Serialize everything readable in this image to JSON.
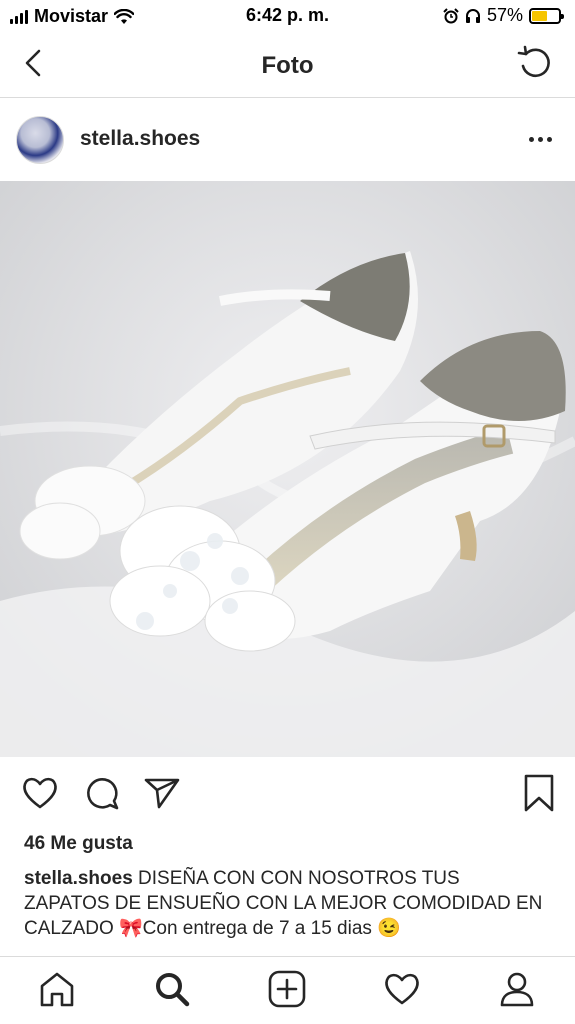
{
  "status_bar": {
    "carrier": "Movistar",
    "time": "6:42 p. m.",
    "battery": "57%",
    "battery_level": 0.57,
    "battery_color": "#f6c500"
  },
  "nav": {
    "title": "Foto",
    "back_icon": "chevron-left-icon",
    "refresh_icon": "refresh-icon"
  },
  "post": {
    "username": "stella.shoes",
    "more_icon": "more-horizontal-icon",
    "photo_alt": "bridal-shoes-photo"
  },
  "actions": {
    "like_icon": "heart-icon",
    "comment_icon": "comment-icon",
    "share_icon": "send-icon",
    "save_icon": "bookmark-icon"
  },
  "likes_text": "46 Me gusta",
  "caption": {
    "username": "stella.shoes",
    "text": " DISEÑA CON CON NOSOTROS TUS ZAPATOS DE ENSUEÑO CON LA MEJOR COMODIDAD EN CALZADO 🎀Con entrega de  7 a 15 dias  😉"
  },
  "tabbar": {
    "items": [
      "home-icon",
      "search-icon",
      "add-post-icon",
      "activity-heart-icon",
      "profile-icon"
    ]
  }
}
